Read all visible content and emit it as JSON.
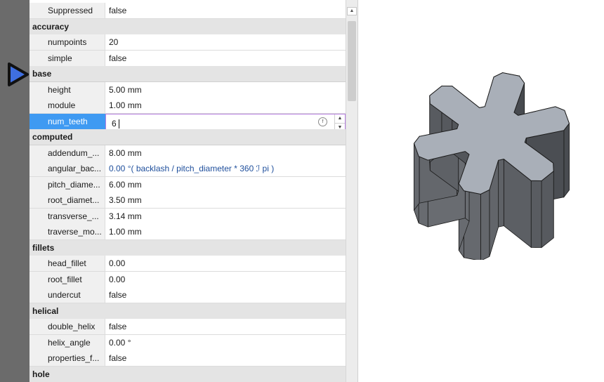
{
  "properties": [
    {
      "kind": "prop",
      "key": "Suppressed",
      "value": "false"
    },
    {
      "kind": "group",
      "label": "accuracy"
    },
    {
      "kind": "prop",
      "key": "numpoints",
      "value": "20"
    },
    {
      "kind": "prop",
      "key": "simple",
      "value": "false"
    },
    {
      "kind": "group",
      "label": "base"
    },
    {
      "kind": "prop",
      "key": "height",
      "value": "5.00 mm"
    },
    {
      "kind": "prop",
      "key": "module",
      "value": "1.00 mm"
    },
    {
      "kind": "edit",
      "key": "num_teeth",
      "value": "6"
    },
    {
      "kind": "group",
      "label": "computed"
    },
    {
      "kind": "prop",
      "key": "addendum_...",
      "value": "8.00 mm"
    },
    {
      "kind": "prop",
      "key": "angular_bac...",
      "value": "0.00 °( backlash / pitch_diameter * 360 ℐ pi )",
      "expr": true
    },
    {
      "kind": "prop",
      "key": "pitch_diame...",
      "value": "6.00 mm"
    },
    {
      "kind": "prop",
      "key": "root_diamet...",
      "value": "3.50 mm"
    },
    {
      "kind": "prop",
      "key": "transverse_...",
      "value": "3.14 mm"
    },
    {
      "kind": "prop",
      "key": "traverse_mo...",
      "value": "1.00 mm"
    },
    {
      "kind": "group",
      "label": "fillets"
    },
    {
      "kind": "prop",
      "key": "head_fillet",
      "value": "0.00"
    },
    {
      "kind": "prop",
      "key": "root_fillet",
      "value": "0.00"
    },
    {
      "kind": "prop",
      "key": "undercut",
      "value": "false"
    },
    {
      "kind": "group",
      "label": "helical"
    },
    {
      "kind": "prop",
      "key": "double_helix",
      "value": "false"
    },
    {
      "kind": "prop",
      "key": "helix_angle",
      "value": "0.00 °"
    },
    {
      "kind": "prop",
      "key": "properties_f...",
      "value": "false"
    },
    {
      "kind": "group",
      "label": "hole"
    }
  ],
  "icons": {
    "expression": "fx-icon",
    "spin": "spinbox-arrows-icon",
    "pointer": "play-arrow-icon",
    "model": "gear-model-icon"
  },
  "colors": {
    "selection": "#3f9af2",
    "edit_border": "#b67fe0",
    "expression_text": "#1f4f9c",
    "gear_top": "#a9afb8",
    "gear_side": "#5a5e64"
  },
  "gear": {
    "teeth": 6
  }
}
